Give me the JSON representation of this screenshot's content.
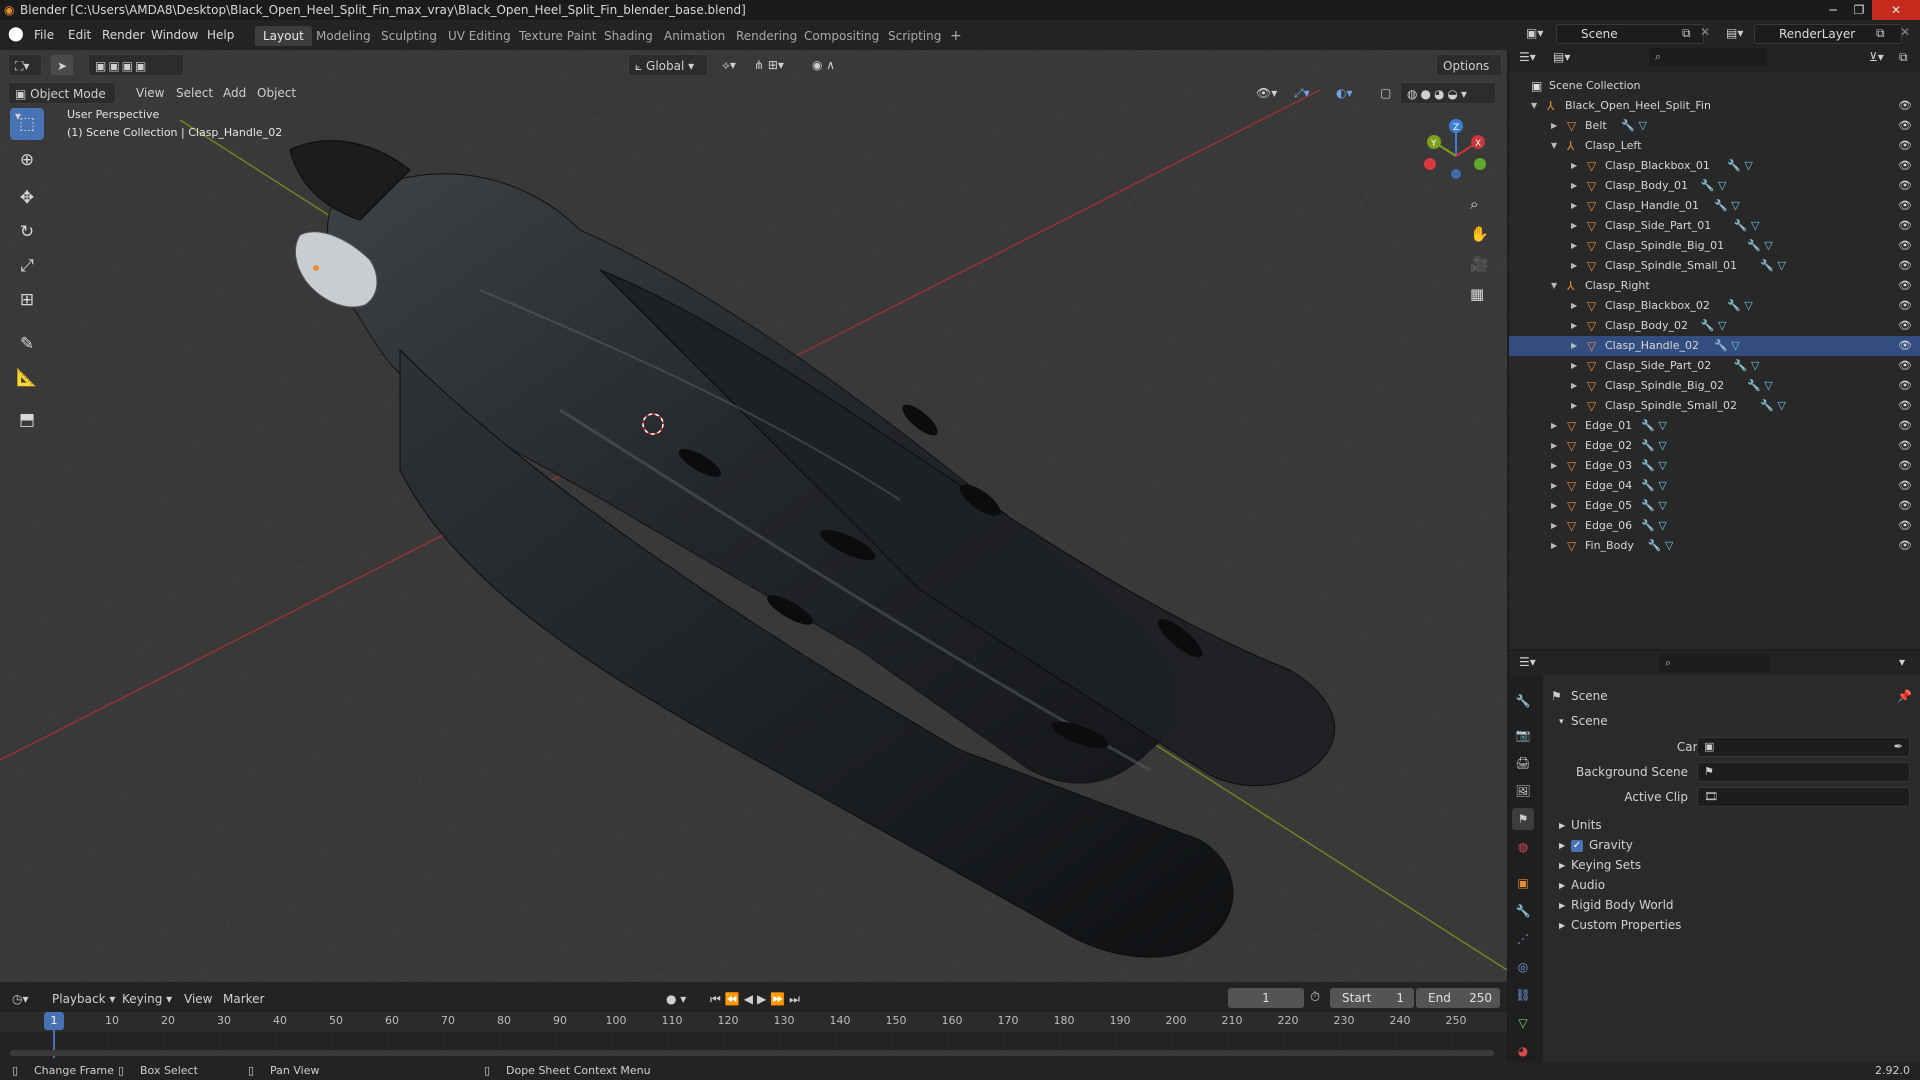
{
  "window": {
    "title": "Blender [C:\\Users\\AMDA8\\Desktop\\Black_Open_Heel_Split_Fin_max_vray\\Black_Open_Heel_Split_Fin_blender_base.blend]"
  },
  "menubar": {
    "menus": [
      "File",
      "Edit",
      "Render",
      "Window",
      "Help"
    ],
    "workspaces": [
      "Layout",
      "Modeling",
      "Sculpting",
      "UV Editing",
      "Texture Paint",
      "Shading",
      "Animation",
      "Rendering",
      "Compositing",
      "Scripting"
    ],
    "active_workspace": "Layout",
    "add_workspace": "+",
    "scene_name": "Scene",
    "view_layer": "RenderLayer"
  },
  "viewport": {
    "mode": "Object Mode",
    "menus": [
      "View",
      "Select",
      "Add",
      "Object"
    ],
    "orientation": "Global",
    "options": "Options",
    "overlay_line1": "User Perspective",
    "overlay_line2": "(1) Scene Collection | Clasp_Handle_02",
    "gizmo_axes": [
      "X",
      "Y",
      "Z"
    ]
  },
  "outliner": {
    "root": "Scene Collection",
    "rows": [
      {
        "label": "Black_Open_Heel_Split_Fin",
        "depth": 1,
        "type": "empty",
        "expanded": true
      },
      {
        "label": "Belt",
        "depth": 2,
        "type": "mesh",
        "expanded": false
      },
      {
        "label": "Clasp_Left",
        "depth": 2,
        "type": "empty",
        "expanded": true
      },
      {
        "label": "Clasp_Blackbox_01",
        "depth": 3,
        "type": "mesh",
        "expanded": false
      },
      {
        "label": "Clasp_Body_01",
        "depth": 3,
        "type": "mesh",
        "expanded": false
      },
      {
        "label": "Clasp_Handle_01",
        "depth": 3,
        "type": "mesh",
        "expanded": false
      },
      {
        "label": "Clasp_Side_Part_01",
        "depth": 3,
        "type": "mesh",
        "expanded": false
      },
      {
        "label": "Clasp_Spindle_Big_01",
        "depth": 3,
        "type": "mesh",
        "expanded": false
      },
      {
        "label": "Clasp_Spindle_Small_01",
        "depth": 3,
        "type": "mesh",
        "expanded": false
      },
      {
        "label": "Clasp_Right",
        "depth": 2,
        "type": "empty",
        "expanded": true
      },
      {
        "label": "Clasp_Blackbox_02",
        "depth": 3,
        "type": "mesh",
        "expanded": false
      },
      {
        "label": "Clasp_Body_02",
        "depth": 3,
        "type": "mesh",
        "expanded": false
      },
      {
        "label": "Clasp_Handle_02",
        "depth": 3,
        "type": "mesh",
        "expanded": false,
        "active": true
      },
      {
        "label": "Clasp_Side_Part_02",
        "depth": 3,
        "type": "mesh",
        "expanded": false
      },
      {
        "label": "Clasp_Spindle_Big_02",
        "depth": 3,
        "type": "mesh",
        "expanded": false
      },
      {
        "label": "Clasp_Spindle_Small_02",
        "depth": 3,
        "type": "mesh",
        "expanded": false
      },
      {
        "label": "Edge_01",
        "depth": 2,
        "type": "mesh",
        "expanded": false
      },
      {
        "label": "Edge_02",
        "depth": 2,
        "type": "mesh",
        "expanded": false
      },
      {
        "label": "Edge_03",
        "depth": 2,
        "type": "mesh",
        "expanded": false
      },
      {
        "label": "Edge_04",
        "depth": 2,
        "type": "mesh",
        "expanded": false
      },
      {
        "label": "Edge_05",
        "depth": 2,
        "type": "mesh",
        "expanded": false
      },
      {
        "label": "Edge_06",
        "depth": 2,
        "type": "mesh",
        "expanded": false
      },
      {
        "label": "Fin_Body",
        "depth": 2,
        "type": "mesh",
        "expanded": false
      }
    ]
  },
  "properties": {
    "context": "Scene",
    "panel": "Scene",
    "fields": [
      {
        "label": "Camera",
        "value": ""
      },
      {
        "label": "Background Scene",
        "value": ""
      },
      {
        "label": "Active Clip",
        "value": ""
      }
    ],
    "subpanels": [
      {
        "label": "Units",
        "checkbox": false
      },
      {
        "label": "Gravity",
        "checkbox": true
      },
      {
        "label": "Keying Sets",
        "checkbox": false
      },
      {
        "label": "Audio",
        "checkbox": false
      },
      {
        "label": "Rigid Body World",
        "checkbox": false
      },
      {
        "label": "Custom Properties",
        "checkbox": false
      }
    ]
  },
  "timeline": {
    "menus": [
      "Playback",
      "Keying",
      "View",
      "Marker"
    ],
    "current_frame": "1",
    "start_label": "Start",
    "start": "1",
    "end_label": "End",
    "end": "250",
    "ticks": [
      "10",
      "20",
      "30",
      "40",
      "50",
      "60",
      "70",
      "80",
      "90",
      "100",
      "110",
      "120",
      "130",
      "140",
      "150",
      "160",
      "170",
      "180",
      "190",
      "200",
      "210",
      "220",
      "230",
      "240",
      "250"
    ],
    "playhead": "1"
  },
  "statusbar": {
    "items": [
      "Change Frame",
      "Box Select",
      "Pan View",
      "Dope Sheet Context Menu"
    ],
    "version": "2.92.0"
  },
  "colors": {
    "accent": "#4772b3",
    "x_axis": "#c8353b",
    "y_axis": "#7ea11c",
    "z_axis": "#3d7fd6",
    "mesh_icon": "#e88c34",
    "active_frame": "#4772b3"
  }
}
